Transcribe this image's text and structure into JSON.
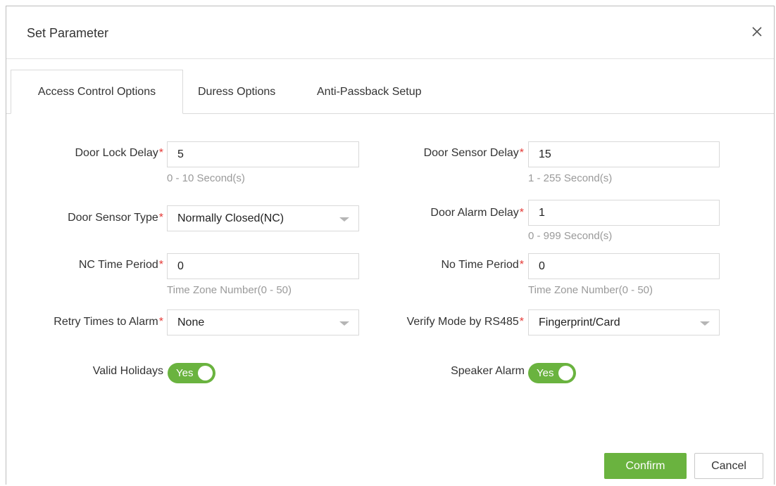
{
  "dialog": {
    "title": "Set Parameter",
    "close_icon": "close-icon"
  },
  "tabs": [
    {
      "label": "Access Control Options",
      "active": true
    },
    {
      "label": "Duress Options",
      "active": false
    },
    {
      "label": "Anti-Passback Setup",
      "active": false
    }
  ],
  "form": {
    "required_marker": "*",
    "door_lock_delay": {
      "label": "Door Lock Delay",
      "value": "5",
      "hint": "0 - 10 Second(s)"
    },
    "door_sensor_delay": {
      "label": "Door Sensor Delay",
      "value": "15",
      "hint": "1 - 255 Second(s)"
    },
    "door_sensor_type": {
      "label": "Door Sensor Type",
      "value": "Normally Closed(NC)"
    },
    "door_alarm_delay": {
      "label": "Door Alarm Delay",
      "value": "1",
      "hint": "0 - 999 Second(s)"
    },
    "nc_time_period": {
      "label": "NC Time Period",
      "value": "0",
      "hint": "Time Zone Number(0 - 50)"
    },
    "no_time_period": {
      "label": "No Time Period",
      "value": "0",
      "hint": "Time Zone Number(0 - 50)"
    },
    "retry_times_to_alarm": {
      "label": "Retry Times to Alarm",
      "value": "None"
    },
    "verify_mode_by_rs485": {
      "label": "Verify Mode by RS485",
      "value": "Fingerprint/Card"
    },
    "valid_holidays": {
      "label": "Valid Holidays",
      "state": "Yes"
    },
    "speaker_alarm": {
      "label": "Speaker Alarm",
      "state": "Yes"
    }
  },
  "buttons": {
    "confirm": "Confirm",
    "cancel": "Cancel"
  },
  "colors": {
    "accent_green": "#6ab33f",
    "required_red": "#e53935",
    "hint_gray": "#9a9a9a"
  }
}
